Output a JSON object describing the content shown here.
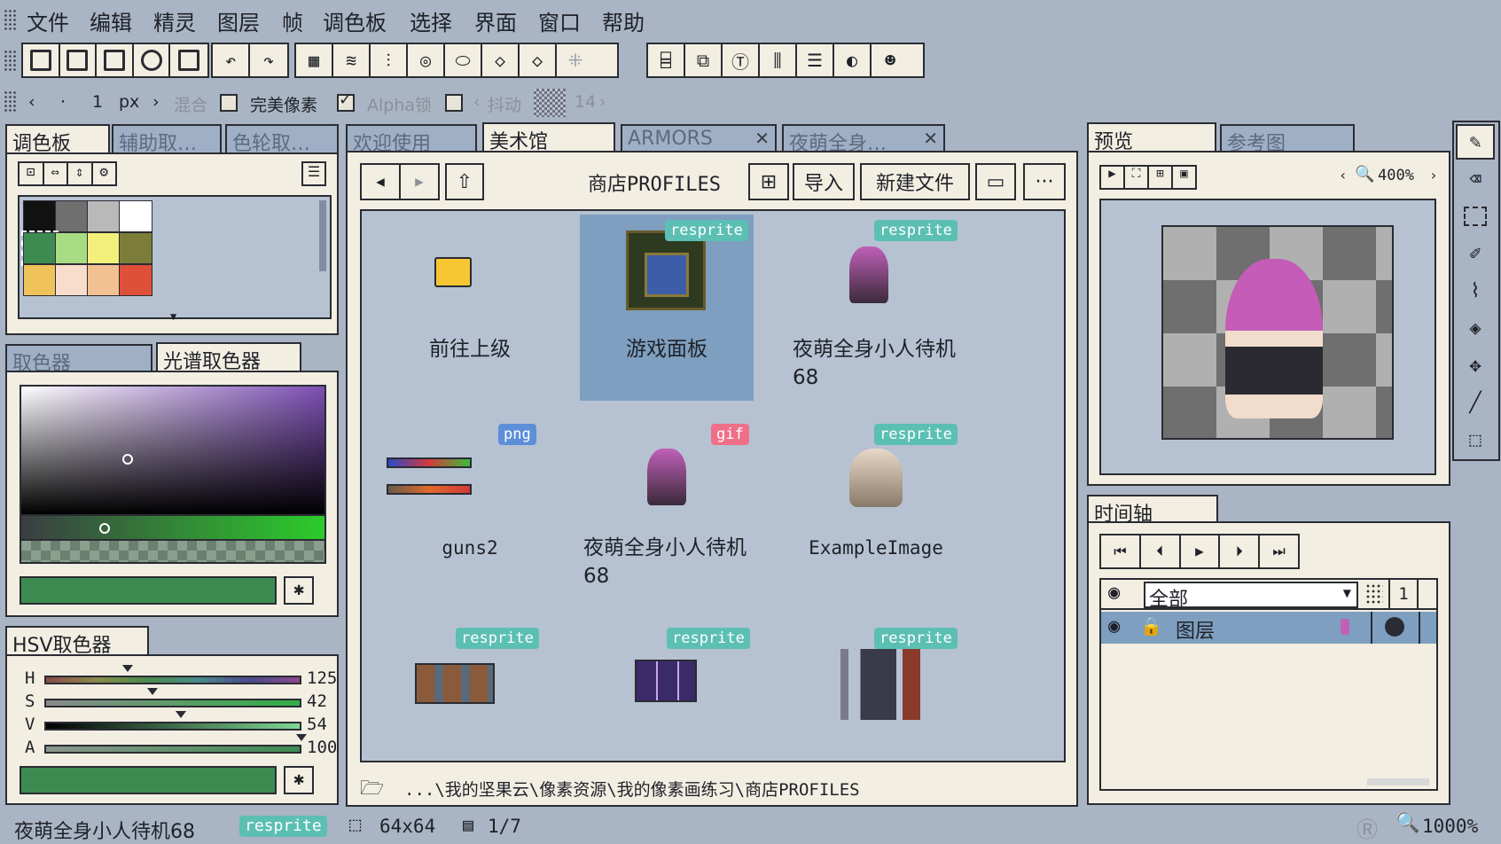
{
  "menu": [
    "文件",
    "编辑",
    "精灵",
    "图层",
    "帧",
    "调色板",
    "选择",
    "界面",
    "窗口",
    "帮助"
  ],
  "options": {
    "size_value": "1",
    "size_unit": "px",
    "blend_label": "混合",
    "pixel_perfect_label": "完美像素",
    "alpha_lock_label": "Alpha锁",
    "dither_label": "抖动",
    "dither_value": "14"
  },
  "palette_panel": {
    "tabs": [
      "调色板",
      "辅助取…",
      "色轮取…"
    ],
    "colors": [
      "#121212",
      "#6f6f6f",
      "#b9b9b9",
      "#ffffff",
      "#3e8b52",
      "#a8dc82",
      "#f2f07a",
      "#7d7d3a",
      "#f0c35a",
      "#f8dccc",
      "#f3c092",
      "#de5038"
    ]
  },
  "picker_panel": {
    "tabs": [
      "取色器",
      "光谱取色器"
    ],
    "current_color": "#3e8b52"
  },
  "hsv_panel": {
    "title": "HSV取色器",
    "rows": [
      {
        "label": "H",
        "value": "125"
      },
      {
        "label": "S",
        "value": "42"
      },
      {
        "label": "V",
        "value": "54"
      },
      {
        "label": "A",
        "value": "100"
      }
    ]
  },
  "browser": {
    "tabs": [
      "欢迎使用",
      "美术馆",
      "ARMORS",
      "夜萌全身…"
    ],
    "folder_title": "商店PROFILES",
    "import_label": "导入",
    "new_file_label": "新建文件",
    "more_label": "···",
    "items": [
      {
        "name": "前往上级",
        "badge": ""
      },
      {
        "name": "游戏面板",
        "badge": "resprite"
      },
      {
        "name": "夜萌全身小人待机68",
        "badge": "resprite"
      },
      {
        "name": "guns2",
        "badge": "png"
      },
      {
        "name": "夜萌全身小人待机68",
        "badge": "gif"
      },
      {
        "name": "ExampleImage",
        "badge": "resprite"
      },
      {
        "name": "",
        "badge": "resprite"
      },
      {
        "name": "",
        "badge": "resprite"
      },
      {
        "name": "",
        "badge": "resprite"
      }
    ],
    "path": "...\\我的坚果云\\像素资源\\我的像素画练习\\商店PROFILES"
  },
  "preview_panel": {
    "tabs": [
      "预览",
      "参考图"
    ],
    "zoom": "400%"
  },
  "timeline_panel": {
    "title": "时间轴",
    "layer_filter": "全部",
    "frame_number": "1",
    "layer_name": "图层"
  },
  "status": {
    "file_name": "夜萌全身小人待机68",
    "file_badge": "resprite",
    "canvas_size": "64x64",
    "frame": "1/7",
    "zoom": "1000%"
  }
}
